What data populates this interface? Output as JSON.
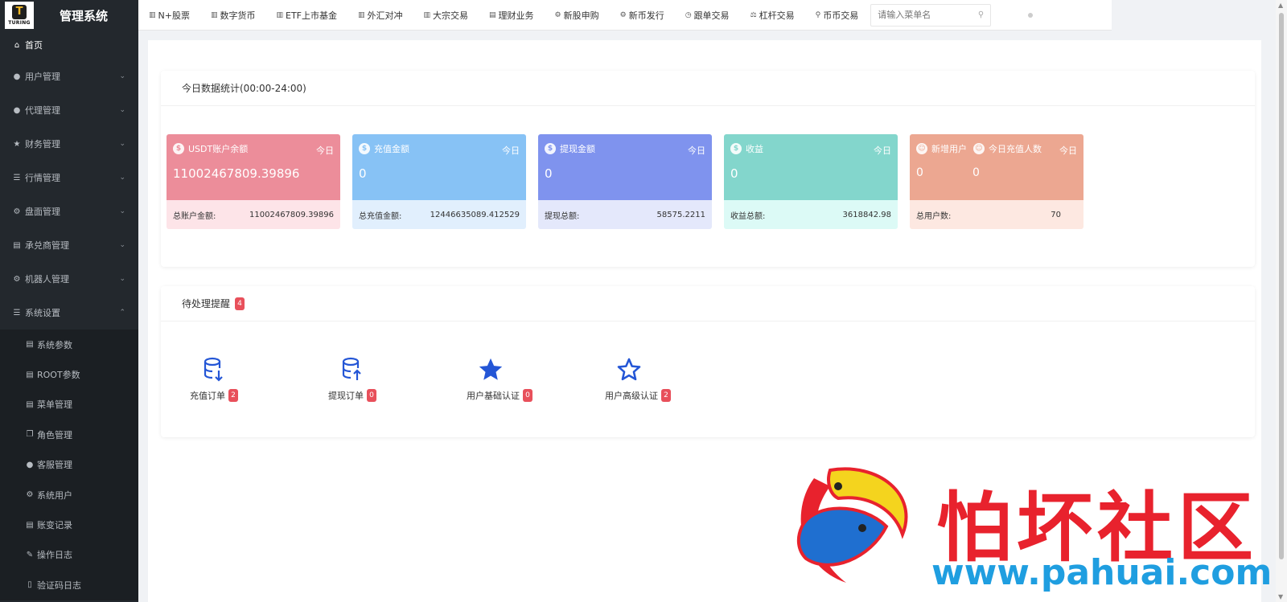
{
  "brand": {
    "logo_text": "TURING",
    "logo_mark": "T",
    "title": "管理系统"
  },
  "sidebar": {
    "home": "首页",
    "menus": [
      {
        "label": "用户管理",
        "icon": "user-icon"
      },
      {
        "label": "代理管理",
        "icon": "user-icon"
      },
      {
        "label": "财务管理",
        "icon": "star-icon"
      },
      {
        "label": "行情管理",
        "icon": "list-icon"
      },
      {
        "label": "盘面管理",
        "icon": "gear-icon"
      },
      {
        "label": "承兑商管理",
        "icon": "table-icon"
      },
      {
        "label": "机器人管理",
        "icon": "gear-icon"
      },
      {
        "label": "系统设置",
        "icon": "list-icon"
      }
    ],
    "sub_items": [
      {
        "label": "系统参数",
        "icon": "table-icon"
      },
      {
        "label": "ROOT参数",
        "icon": "table-icon"
      },
      {
        "label": "菜单管理",
        "icon": "table-icon"
      },
      {
        "label": "角色管理",
        "icon": "copy-icon"
      },
      {
        "label": "客服管理",
        "icon": "user-icon"
      },
      {
        "label": "系统用户",
        "icon": "gear-icon"
      },
      {
        "label": "账变记录",
        "icon": "table-icon"
      },
      {
        "label": "操作日志",
        "icon": "edit-icon"
      },
      {
        "label": "验证码日志",
        "icon": "file-icon"
      }
    ]
  },
  "topnav": {
    "items": [
      "N+股票",
      "数字货币",
      "ETF上市基金",
      "外汇对冲",
      "大宗交易",
      "理财业务",
      "新股申购",
      "新币发行",
      "跟单交易",
      "杠杆交易",
      "币币交易"
    ],
    "search_placeholder": "请输入菜单名"
  },
  "stats": {
    "title": "今日数据统计(00:00-24:00)",
    "today": "今日",
    "cards": [
      {
        "title": "USDT账户余额",
        "value": "11002467809.39896",
        "bottom_label": "总账户金额:",
        "bottom_value": "11002467809.39896",
        "top_color": "#ec8d9a",
        "bottom_color": "#fde4e8"
      },
      {
        "title": "充值金额",
        "value": "0",
        "bottom_label": "总充值金额:",
        "bottom_value": "12446635089.412529",
        "top_color": "#87c2f5",
        "bottom_color": "#e1effd"
      },
      {
        "title": "提现金额",
        "value": "0",
        "bottom_label": "提现总额:",
        "bottom_value": "58575.2211",
        "top_color": "#7f93ee",
        "bottom_color": "#e4e8fb"
      },
      {
        "title": "收益",
        "value": "0",
        "bottom_label": "收益总额:",
        "bottom_value": "3618842.98",
        "top_color": "#83d6cc",
        "bottom_color": "#dcfaf6"
      }
    ],
    "card5": {
      "title_a": "新增用户",
      "title_b": "今日充值人数",
      "value_a": "0",
      "value_b": "0",
      "bottom_label": "总用户数:",
      "bottom_value": "70",
      "top_color": "#eca791",
      "bottom_color": "#fde8e1"
    }
  },
  "pending": {
    "title": "待处理提醒",
    "count": "4",
    "items": [
      {
        "label": "充值订单",
        "count": "2",
        "icon": "database-down-icon"
      },
      {
        "label": "提现订单",
        "count": "0",
        "icon": "database-up-icon"
      },
      {
        "label": "用户基础认证",
        "count": "0",
        "icon": "star-filled-icon"
      },
      {
        "label": "用户高级认证",
        "count": "2",
        "icon": "star-outline-icon"
      }
    ]
  },
  "watermark": {
    "text": "怕坏社区",
    "url": "www.pahuai.com"
  },
  "colors": {
    "sidebar_bg": "#23282d",
    "accent_blue": "#2456d6",
    "badge_red": "#e8505b"
  }
}
